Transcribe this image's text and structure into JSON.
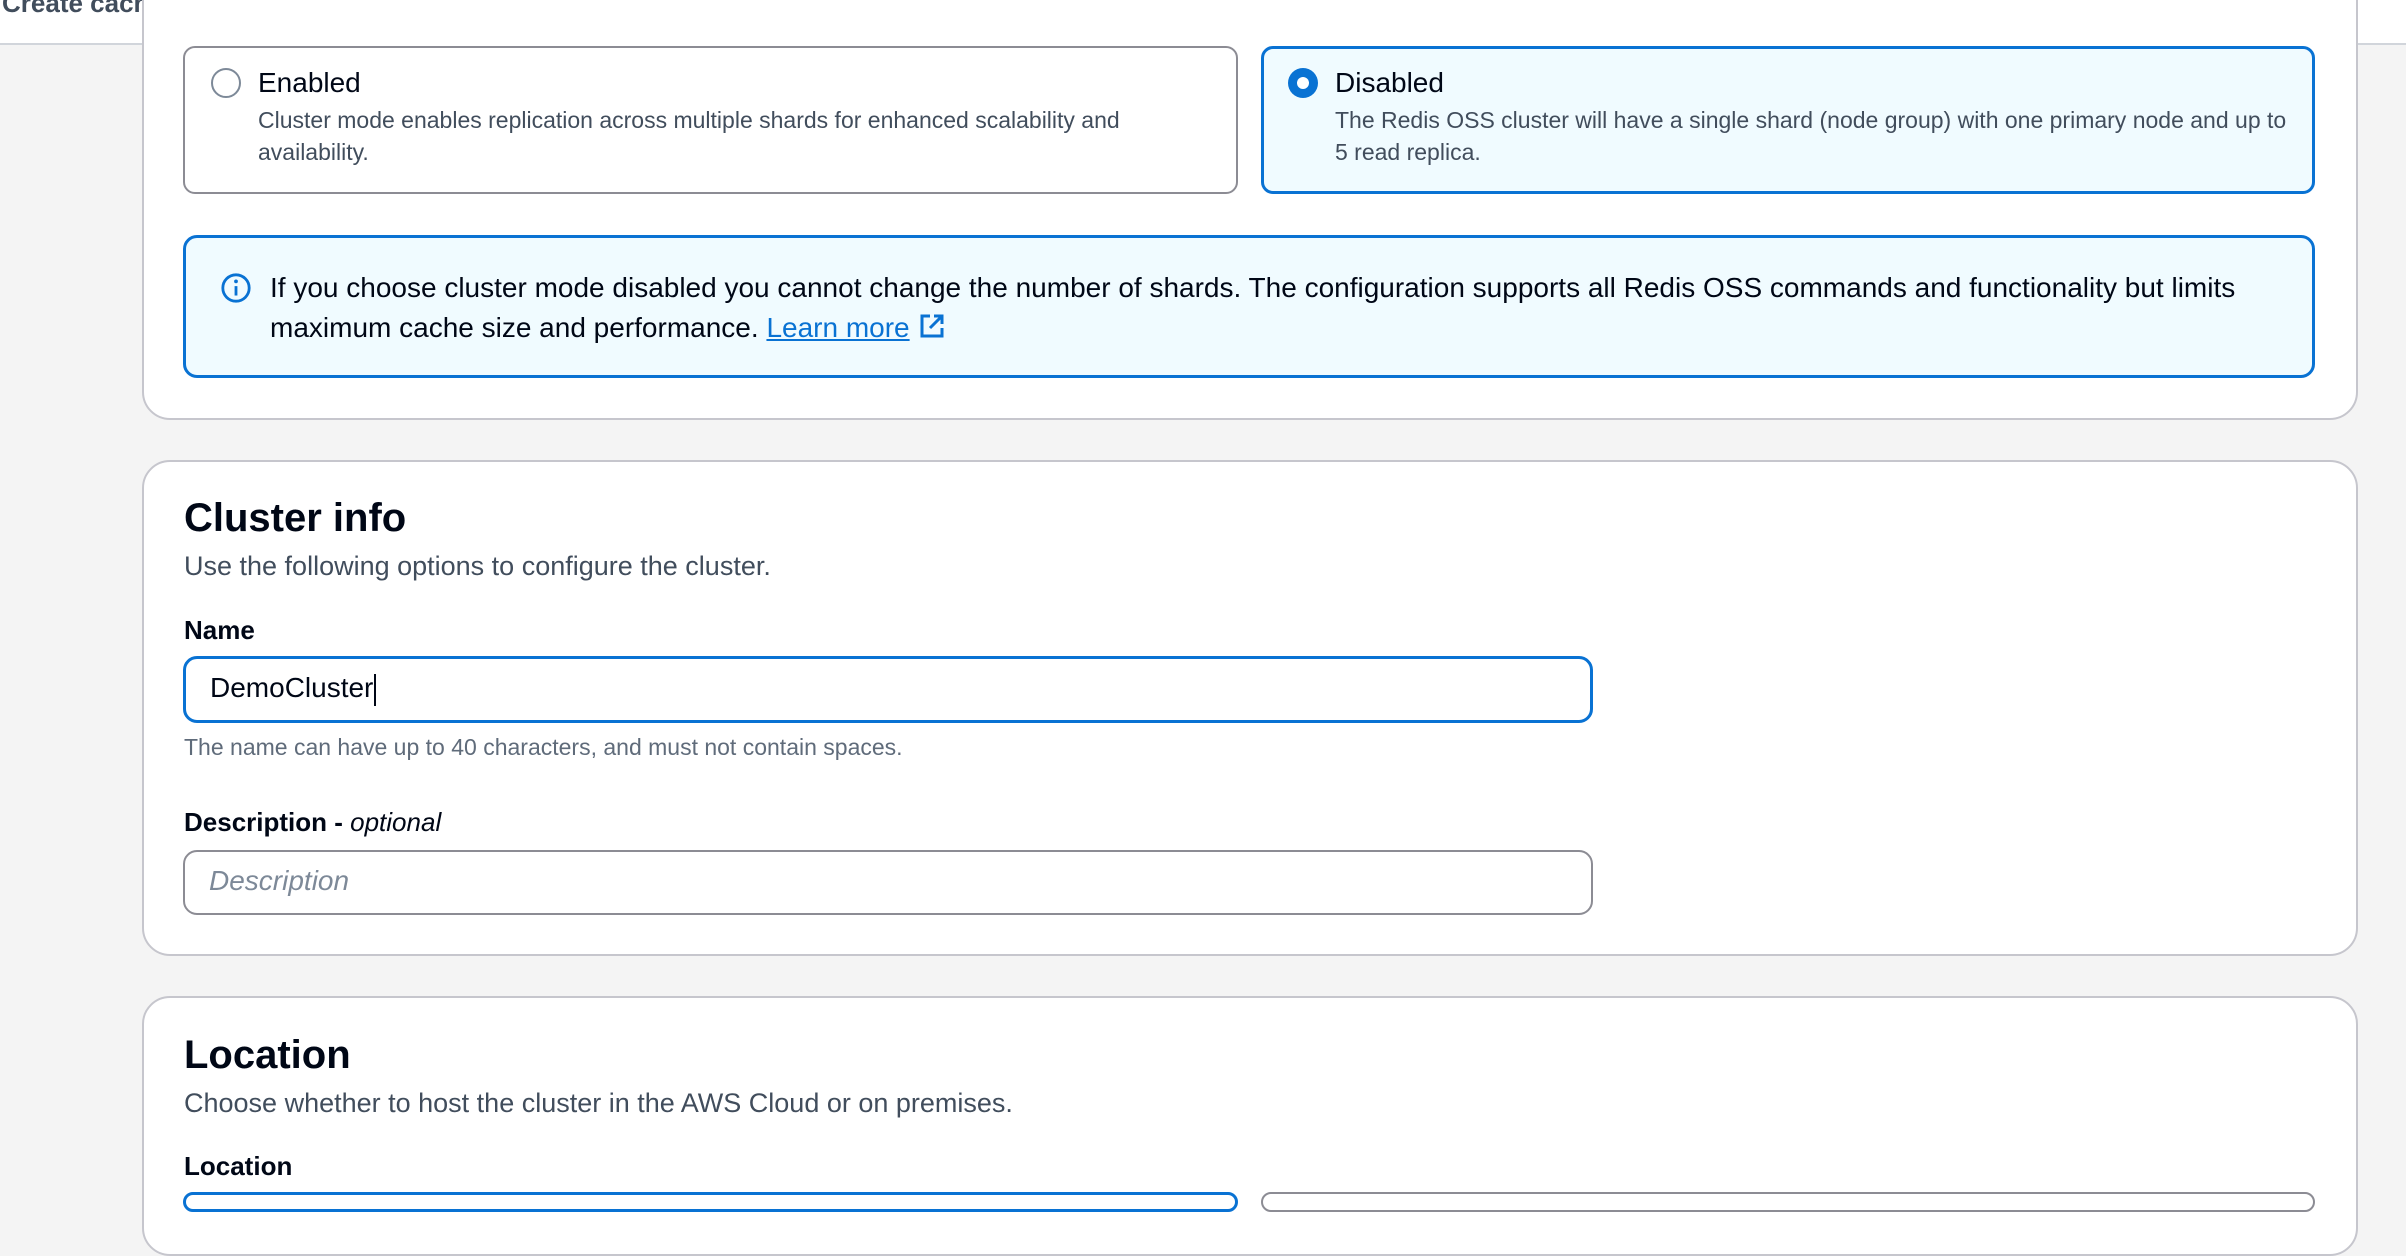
{
  "header": {
    "title": "Create cache"
  },
  "cluster_mode": {
    "options": [
      {
        "title": "Enabled",
        "description": "Cluster mode enables replication across multiple shards for enhanced scalability and availability.",
        "selected": false
      },
      {
        "title": "Disabled",
        "description": "The Redis OSS cluster will have a single shard (node group) with one primary node and up to 5 read replica.",
        "selected": true
      }
    ],
    "alert": {
      "text": "If you choose cluster mode disabled you cannot change the number of shards. The configuration supports all Redis OSS commands and functionality but limits maximum cache size and performance.",
      "link": "Learn more"
    }
  },
  "cluster_info": {
    "heading": "Cluster info",
    "description": "Use the following options to configure the cluster.",
    "name_label": "Name",
    "name_value": "DemoCluster",
    "name_hint": "The name can have up to 40 characters, and must not contain spaces.",
    "description_label": "Description",
    "description_optional": "optional",
    "description_placeholder": "Description"
  },
  "location": {
    "heading": "Location",
    "description": "Choose whether to host the cluster in the AWS Cloud or on premises.",
    "label": "Location"
  },
  "colors": {
    "accent": "#0972d3",
    "accent_bg": "#f0fbff"
  }
}
